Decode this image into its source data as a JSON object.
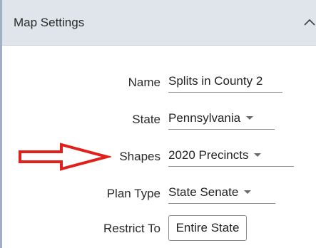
{
  "header": {
    "title": "Map Settings",
    "collapse_icon": "chevron-up-icon"
  },
  "fields": {
    "name": {
      "label": "Name",
      "value": "Splits in County 2"
    },
    "state": {
      "label": "State",
      "value": "Pennsylvania"
    },
    "shapes": {
      "label": "Shapes",
      "value": "2020 Precincts"
    },
    "plan_type": {
      "label": "Plan Type",
      "value": "State Senate"
    },
    "restrict_to": {
      "label": "Restrict To",
      "value": "Entire State"
    }
  },
  "annotation": {
    "color": "#e0201b",
    "points_to": "shapes"
  },
  "colors": {
    "header_bg": "#dfe5ea",
    "annotation": "#e0201b"
  }
}
